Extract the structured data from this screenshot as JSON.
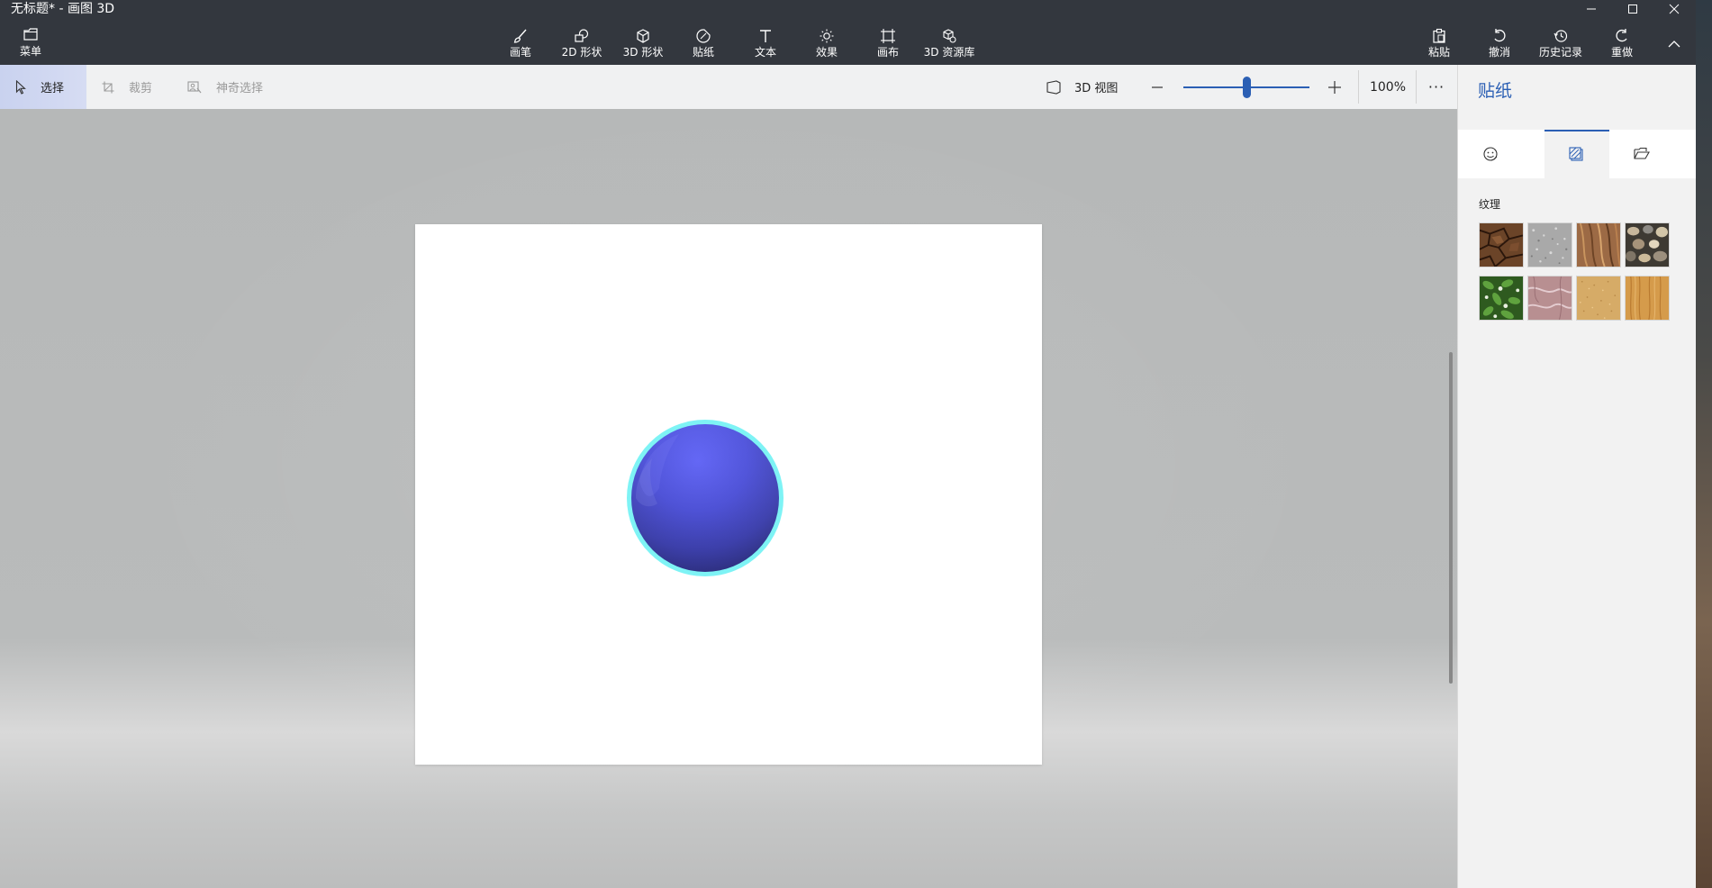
{
  "window": {
    "title": "无标题* - 画图 3D",
    "controls": [
      "minimize",
      "maximize",
      "close"
    ]
  },
  "ribbon": {
    "menu_label": "菜单",
    "tools": [
      {
        "id": "brushes",
        "label": "画笔",
        "icon": "brush-icon"
      },
      {
        "id": "shapes2d",
        "label": "2D 形状",
        "icon": "shapes-2d-icon"
      },
      {
        "id": "shapes3d",
        "label": "3D 形状",
        "icon": "cube-icon"
      },
      {
        "id": "stickers",
        "label": "贴纸",
        "icon": "sticker-icon"
      },
      {
        "id": "text",
        "label": "文本",
        "icon": "text-icon"
      },
      {
        "id": "effects",
        "label": "效果",
        "icon": "effects-sun-icon"
      },
      {
        "id": "canvas",
        "label": "画布",
        "icon": "canvas-crop-icon"
      },
      {
        "id": "library3d",
        "label": "3D 资源库",
        "icon": "library-3d-icon"
      }
    ],
    "actions": [
      {
        "id": "paste",
        "label": "粘贴",
        "icon": "paste-icon"
      },
      {
        "id": "undo",
        "label": "撤消",
        "icon": "undo-icon"
      },
      {
        "id": "history",
        "label": "历史记录",
        "icon": "history-icon"
      },
      {
        "id": "redo",
        "label": "重做",
        "icon": "redo-icon"
      }
    ]
  },
  "commandbar": {
    "select_label": "选择",
    "crop_label": "裁剪",
    "magic_select_label": "神奇选择",
    "view3d_label": "3D 视图",
    "zoom_percent": "100%",
    "zoom_level": 0.5,
    "more_label": "···"
  },
  "panel": {
    "title": "贴纸",
    "tabs": [
      "stickers-tab",
      "textures-tab",
      "custom-sticker-tab"
    ],
    "active_tab": 1,
    "section_label": "纹理",
    "textures": [
      {
        "name": "cracked-bark",
        "color": "#6b4428"
      },
      {
        "name": "granite-gray",
        "color": "#a9a9a9"
      },
      {
        "name": "hair-brown",
        "color": "#9c6a45"
      },
      {
        "name": "pebbles",
        "color": "#8a7a66"
      },
      {
        "name": "leaves-green",
        "color": "#3f7a2c"
      },
      {
        "name": "marble-pink",
        "color": "#b88f91"
      },
      {
        "name": "sand-tan",
        "color": "#d6ab67"
      },
      {
        "name": "wood-orange",
        "color": "#d59b4b"
      }
    ]
  },
  "colors": {
    "accent": "#2b5fb4",
    "ribbon_bg": "#33373e",
    "sphere_fill": "#4b4fd8",
    "sphere_highlight": "#7ef3f5"
  }
}
